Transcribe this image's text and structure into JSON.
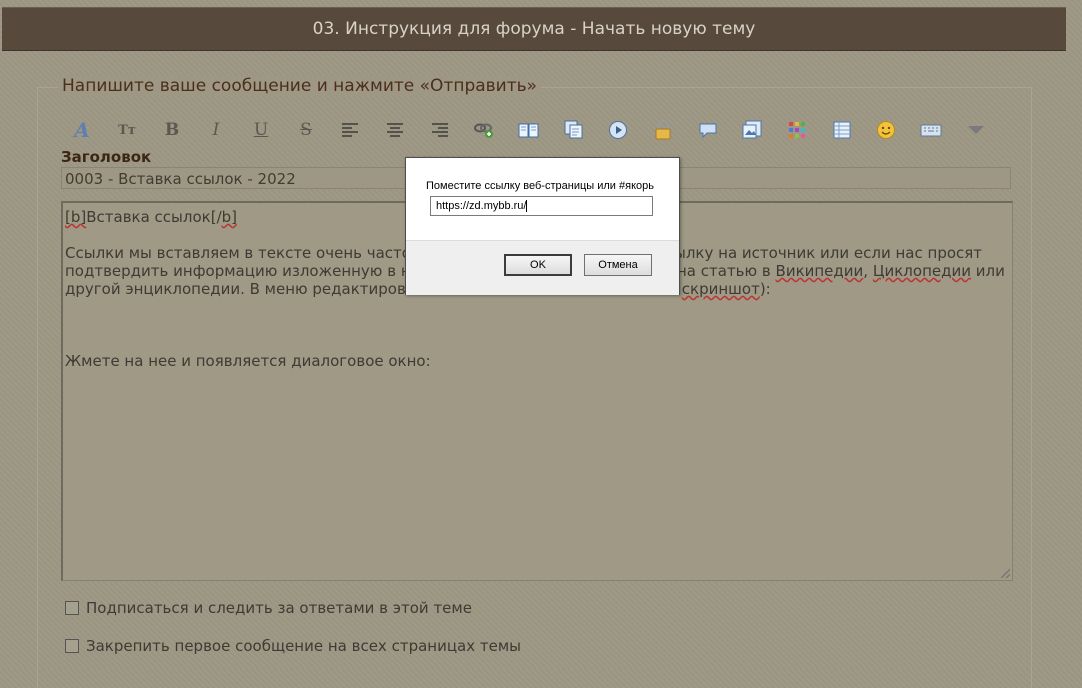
{
  "header": {
    "title": "03. Инструкция для форума - Начать новую тему"
  },
  "form": {
    "legend": "Напишите ваше сообщение и нажмите «Отправить»",
    "subject_label": "Заголовок",
    "subject_value": "0003 - Вставка ссылок - 2022"
  },
  "toolbar": {
    "icons": [
      "font-face-icon",
      "font-size-icon",
      "bold-icon",
      "italic-icon",
      "underline-icon",
      "strikethrough-icon",
      "align-left-icon",
      "align-center-icon",
      "align-right-icon",
      "link-icon",
      "quote-book-icon",
      "copy-icon",
      "video-icon",
      "hide-lock-icon",
      "speech-bubble-icon",
      "image-icon",
      "color-icon",
      "table-icon",
      "smiley-icon",
      "keyboard-icon",
      "more-arrow-icon"
    ],
    "glyphs": {
      "bold": "B",
      "italic": "I",
      "underline": "U",
      "strike": "S",
      "size": "Tт",
      "font": "A"
    }
  },
  "message": {
    "line1_a": "[b]",
    "line1_b": "Вставка ссылок[/",
    "line1_c": "b]",
    "p2_l1": "Ссылки мы вставляем в тексте очень часто,",
    "p2_l1_right": "ылку на источник или если нас просят",
    "p2_l2": "подтвердить информацию изложенную в на",
    "p2_l2_right_a": "на статью в ",
    "p2_l2_wiki": "Википедии",
    "p2_l2_sep": ", ",
    "p2_l2_cyclo": "Циклопедии",
    "p2_l2_end": " или",
    "p2_l3": "другой энциклопедии. В меню редактирован",
    "p2_l3_right_a": " ",
    "p2_l3_screenshot": "скриншот",
    "p2_l3_end": "):",
    "p3": "Жмете на нее и появляется диалоговое окно:"
  },
  "options": {
    "subscribe": "Подписаться и следить за ответами в этой теме",
    "pin": "Закрепить первое сообщение на всех страницах темы"
  },
  "dialog": {
    "prompt": "Поместите ссылку веб-страницы или #якорь",
    "value": "https://zd.mybb.ru/",
    "ok": "OK",
    "cancel": "Отмена"
  }
}
